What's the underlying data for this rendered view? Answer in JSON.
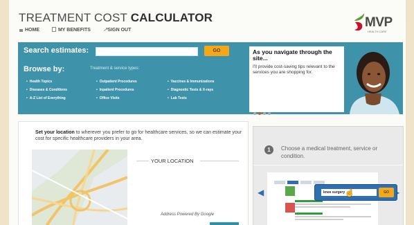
{
  "header": {
    "title_light": "TREATMENT COST ",
    "title_bold": "CALCULATOR",
    "nav": [
      {
        "label": "HOME",
        "icon": "home-icon"
      },
      {
        "label": "MY BENEFITS",
        "icon": "book-icon"
      },
      {
        "label": "SIGN OUT",
        "icon": "signout-arrow-icon"
      }
    ],
    "logo": {
      "text": "MVP",
      "subtext": "HEALTH CARE",
      "colors": {
        "red": "#c8102e",
        "green": "#5a9e2f"
      }
    }
  },
  "search": {
    "label": "Search estimates:",
    "value": "",
    "go_label": "GO"
  },
  "browse": {
    "label": "Browse by:",
    "types_label": "Treatment & service types:",
    "columns": [
      [
        "Health Topics",
        "Diseases & Conditions",
        "A-Z List of Everything"
      ],
      [
        "Outpatient Procedures",
        "Inpatient Procedures",
        "Office Visits"
      ],
      [
        "Vaccines & Immunizations",
        "Diagnostic Tests & X-rays",
        "Lab Tests"
      ]
    ]
  },
  "tip": {
    "heading": "As you navigate through the site...",
    "body": "I'll provide cost-saving tips relevant to the services you are shopping for.",
    "carousel_dots": 4,
    "active_dot": 1
  },
  "location": {
    "intro_bold": "Set your location",
    "intro_rest": " to wherever you prefer to go for healthcare services, so we can estimate your cost for specific healthcare providers in your area.",
    "heading": "YOUR LOCATION",
    "address_note": "Address Powered By Google"
  },
  "step": {
    "number": "1",
    "text": "Choose a medical treatment, service or condition.",
    "demo_search_value": "knee surgery",
    "demo_go_label": "GO"
  },
  "colors": {
    "band": "#3e93aa",
    "go": "#f3a81a",
    "accent_blue": "#2f6fb0",
    "dot_active": "#d5581b"
  }
}
